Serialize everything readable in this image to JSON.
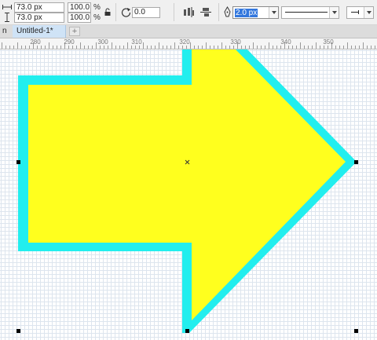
{
  "toolbar": {
    "width_value": "73.0 px",
    "height_value": "73.0 px",
    "scale_x": "100.0",
    "scale_y": "100.0",
    "percent_sign": "%",
    "rotation_value": "0.0",
    "stroke_width": "2.0 px"
  },
  "tabs": {
    "partial_label": "n",
    "active_label": "Untitled-1*"
  },
  "ruler": {
    "labels": [
      "280",
      "290",
      "300",
      "310",
      "320",
      "330",
      "340",
      "350"
    ]
  },
  "colors": {
    "shape_fill": "#ffff1e",
    "shape_outline": "#22eeee",
    "accent": "#3377dd"
  },
  "icons": {
    "width": "width-arrows-icon",
    "height": "height-arrows-icon",
    "lock": "lock-ratio-icon",
    "rotate": "rotate-icon",
    "align_h": "align-horizontal-icon",
    "align_v": "align-vertical-icon",
    "pen": "pen-nib-icon"
  }
}
